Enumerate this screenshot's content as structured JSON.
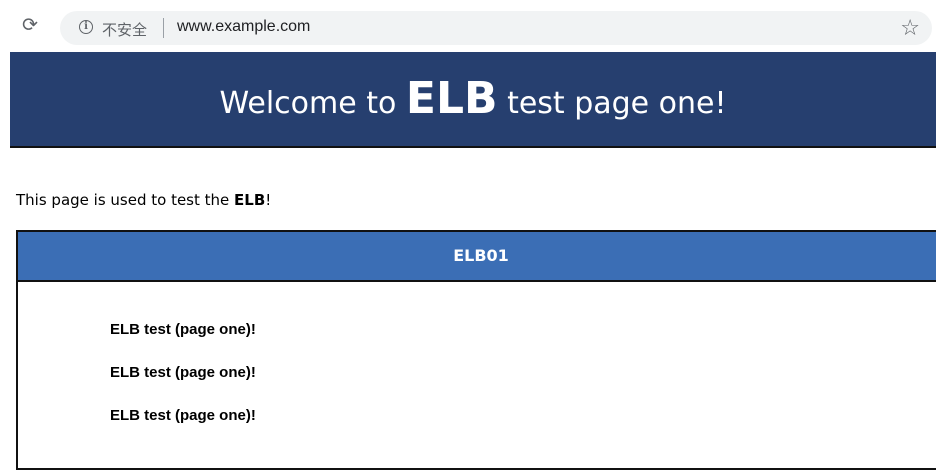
{
  "browser": {
    "security_label": "不安全",
    "url": "www.example.com",
    "reload_icon": "reload-icon",
    "info_icon": "info-icon",
    "bookmark_icon": "star-icon"
  },
  "banner": {
    "prefix": "Welcome to ",
    "emphasis": "ELB",
    "suffix": " test page one!"
  },
  "intro": {
    "prefix": "This page is used to test the ",
    "emphasis": "ELB",
    "suffix": "!"
  },
  "panel": {
    "title": "ELB01",
    "lines": [
      "ELB test (page one)!",
      "ELB test (page one)!",
      "ELB test (page one)!"
    ]
  },
  "colors": {
    "banner_bg": "#263f6f",
    "panel_header_bg": "#3b6eb5"
  }
}
